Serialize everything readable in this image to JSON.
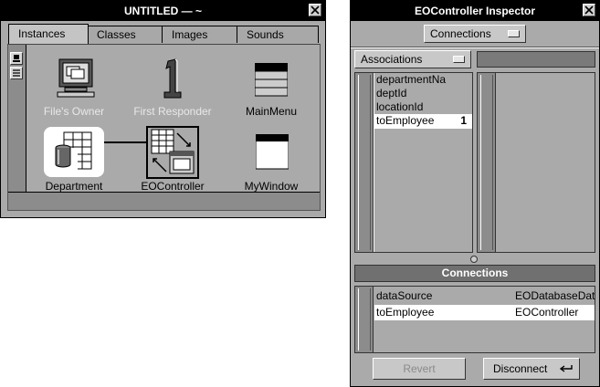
{
  "left_window": {
    "title": "UNTITLED — ~",
    "tabs": [
      {
        "label": "Instances",
        "active": true
      },
      {
        "label": "Classes",
        "active": false
      },
      {
        "label": "Images",
        "active": false
      },
      {
        "label": "Sounds",
        "active": false
      }
    ],
    "icons": [
      {
        "label": "File's Owner",
        "icon": "files-owner-icon",
        "dimmed": true
      },
      {
        "label": "First Responder",
        "icon": "first-responder-icon",
        "dimmed": true
      },
      {
        "label": "MainMenu",
        "icon": "main-menu-icon",
        "dimmed": false
      },
      {
        "label": "Department",
        "icon": "department-icon",
        "dimmed": false,
        "selected": true
      },
      {
        "label": "EOController",
        "icon": "eocontroller-icon",
        "dimmed": false
      },
      {
        "label": "MyWindow",
        "icon": "window-icon",
        "dimmed": false
      }
    ]
  },
  "inspector": {
    "title": "EOController Inspector",
    "mode_popup": "Connections",
    "associations_popup": "Associations",
    "attributes": [
      {
        "name": "departmentNa",
        "count": ""
      },
      {
        "name": "deptId",
        "count": ""
      },
      {
        "name": "locationId",
        "count": ""
      },
      {
        "name": "toEmployee",
        "count": "1",
        "selected": true
      }
    ],
    "connections_header": "Connections",
    "connections": [
      {
        "outlet": "dataSource",
        "target": "EODatabaseDat",
        "selected": false
      },
      {
        "outlet": "toEmployee",
        "target": "EOController",
        "selected": true
      }
    ],
    "revert_label": "Revert",
    "disconnect_label": "Disconnect"
  },
  "colors": {
    "window_gray": "#aaaaaa",
    "dark_gray": "#555555",
    "title_black": "#000000",
    "highlight_white": "#ffffff"
  }
}
